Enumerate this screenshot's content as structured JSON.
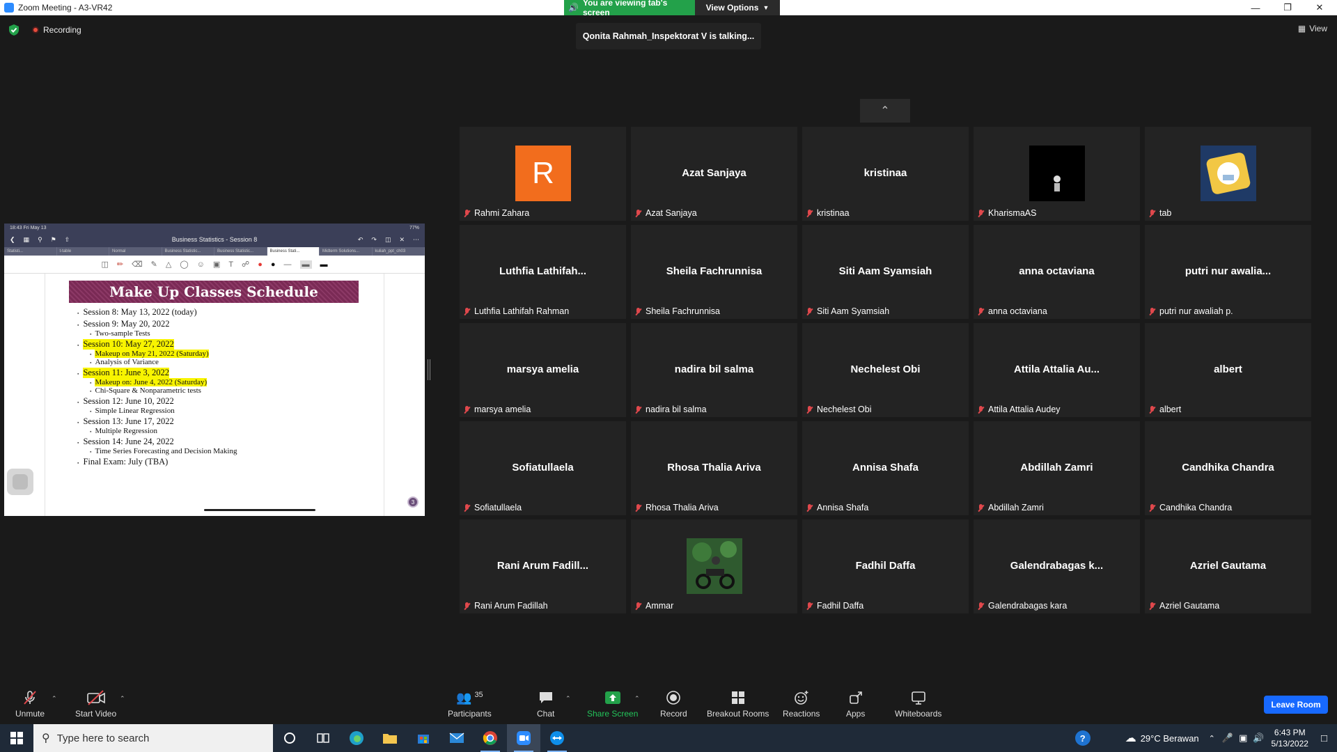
{
  "window": {
    "title": "Zoom Meeting - A3-VR42"
  },
  "banner": {
    "viewing": "You are viewing tab's screen",
    "view_options": "View Options"
  },
  "status": {
    "recording": "Recording",
    "talking": "Qonita Rahmah_Inspektorat V is talking...",
    "view": "View"
  },
  "share": {
    "ipad_time": "18:43  Fri May 13",
    "ipad_battery": "77%",
    "doc_title": "Business Statistics - Session 8",
    "tabs": [
      "Statisti...",
      "t-table",
      "Normal",
      "Business Statistic...",
      "Business Statistic...",
      "Business Stati...",
      "Midterm Solutions...",
      "kuliah_ppt_ch03"
    ],
    "slide_title": "Make Up Classes Schedule",
    "items": [
      {
        "main": "Session 8: May 13, 2022 (today)",
        "highlight": false,
        "subs": []
      },
      {
        "main": "Session 9: May 20, 2022",
        "highlight": false,
        "subs": [
          {
            "text": "Two-sample Tests",
            "highlight": false
          }
        ]
      },
      {
        "main": "Session 10: May 27, 2022",
        "highlight": true,
        "subs": [
          {
            "text": "Makeup on May 21, 2022 (Saturday)",
            "highlight": true
          },
          {
            "text": "Analysis of Variance",
            "highlight": false
          }
        ]
      },
      {
        "main": "Session 11: June 3, 2022",
        "highlight": true,
        "subs": [
          {
            "text": "Makeup on: June 4, 2022 (Saturday)",
            "highlight": true
          },
          {
            "text": "Chi-Square & Nonparametric tests",
            "highlight": false
          }
        ]
      },
      {
        "main": "Session 12: June 10, 2022",
        "highlight": false,
        "subs": [
          {
            "text": "Simple Linear Regression",
            "highlight": false
          }
        ]
      },
      {
        "main": "Session 13: June 17, 2022",
        "highlight": false,
        "subs": [
          {
            "text": "Multiple Regression",
            "highlight": false
          }
        ]
      },
      {
        "main": "Session 14: June 24, 2022",
        "highlight": false,
        "subs": [
          {
            "text": "Time Series Forecasting and Decision Making",
            "highlight": false
          }
        ]
      },
      {
        "main": "Final Exam: July (TBA)",
        "highlight": false,
        "subs": []
      }
    ],
    "page_number": "3"
  },
  "participants_grid": [
    {
      "label": "Rahmi Zahara",
      "display": "",
      "avatar": "R"
    },
    {
      "label": "Azat Sanjaya",
      "display": "Azat Sanjaya"
    },
    {
      "label": "kristinaa",
      "display": "kristinaa"
    },
    {
      "label": "KharismaAS",
      "display": "",
      "avatar": "photo-dark"
    },
    {
      "label": "tab",
      "display": "",
      "avatar": "photo-logo"
    },
    {
      "label": "Luthfia Lathifah Rahman",
      "display": "Luthfia  Lathifah..."
    },
    {
      "label": "Sheila Fachrunnisa",
      "display": "Sheila Fachrunnisa"
    },
    {
      "label": "Siti Aam Syamsiah",
      "display": "Siti Aam Syamsiah"
    },
    {
      "label": "anna octaviana",
      "display": "anna octaviana"
    },
    {
      "label": "putri nur awaliah p.",
      "display": "putri  nur  awalia..."
    },
    {
      "label": "marsya amelia",
      "display": "marsya amelia"
    },
    {
      "label": "nadira bil salma",
      "display": "nadira bil salma"
    },
    {
      "label": "Nechelest Obi",
      "display": "Nechelest Obi"
    },
    {
      "label": "Attila Attalia Audey",
      "display": "Attila  Attalia  Au..."
    },
    {
      "label": "albert",
      "display": "albert"
    },
    {
      "label": "Sofiatullaela",
      "display": "Sofiatullaela"
    },
    {
      "label": "Rhosa Thalia Ariva",
      "display": "Rhosa Thalia Ariva"
    },
    {
      "label": "Annisa Shafa",
      "display": "Annisa Shafa"
    },
    {
      "label": "Abdillah Zamri",
      "display": "Abdillah Zamri"
    },
    {
      "label": "Candhika Chandra",
      "display": "Candhika Chandra"
    },
    {
      "label": "Rani Arum Fadillah",
      "display": "Rani  Arum  Fadill..."
    },
    {
      "label": "Ammar",
      "display": "",
      "avatar": "photo-motorcycle"
    },
    {
      "label": "Fadhil Daffa",
      "display": "Fadhil Daffa"
    },
    {
      "label": "Galendrabagas kara",
      "display": "Galendrabagas  k..."
    },
    {
      "label": "Azriel Gautama",
      "display": "Azriel Gautama"
    }
  ],
  "toolbar": {
    "unmute": "Unmute",
    "start_video": "Start Video",
    "participants": "Participants",
    "participants_count": "35",
    "chat": "Chat",
    "share_screen": "Share Screen",
    "record": "Record",
    "breakout": "Breakout Rooms",
    "reactions": "Reactions",
    "apps": "Apps",
    "whiteboards": "Whiteboards",
    "leave": "Leave Room"
  },
  "taskbar": {
    "search_placeholder": "Type here to search",
    "weather": "29°C  Berawan",
    "time": "6:43 PM",
    "date": "5/13/2022"
  },
  "colors": {
    "share_green": "#23a14a",
    "leave_blue": "#1769ff",
    "mute_red": "#e0484c",
    "highlight_yellow": "#f8f400"
  }
}
